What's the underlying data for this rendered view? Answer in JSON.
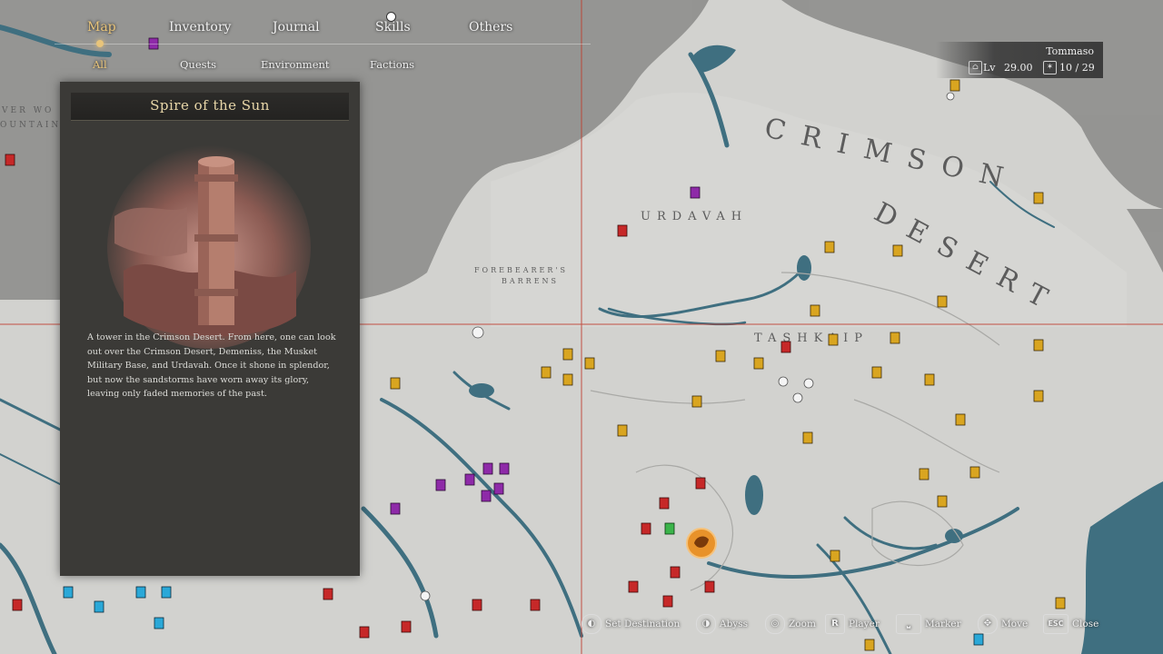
{
  "nav": {
    "tabs": [
      {
        "label": "Map",
        "active": true
      },
      {
        "label": "Inventory",
        "active": false
      },
      {
        "label": "Journal",
        "active": false
      },
      {
        "label": "Skills",
        "active": false
      },
      {
        "label": "Others",
        "active": false
      }
    ],
    "subtabs": [
      {
        "label": "All",
        "active": true
      },
      {
        "label": "Quests",
        "active": false
      },
      {
        "label": "Environment",
        "active": false
      },
      {
        "label": "Factions",
        "active": false
      }
    ]
  },
  "location_panel": {
    "title": "Spire of the Sun",
    "description": "A tower in the Crimson Desert. From here, one can look out over the Crimson Desert, Demeniss, the Musket Military Base, and Urdavah. Once it shone in splendor, but now the sandstorms have worn away its glory, leaving only faded memories of the past."
  },
  "player": {
    "name": "Tommaso",
    "level_label": "Lv",
    "level": "29.00",
    "counter": "10 / 29"
  },
  "map_labels": {
    "crimson": "CRIMSON",
    "desert": "DESERT",
    "urdavah": "URDAVAH",
    "forebearers": "FOREBEARER'S",
    "barrens": "BARRENS",
    "tashkaip": "TASHKAIP",
    "left_edge_1": "VER WO",
    "left_edge_2": "OUNTAIN"
  },
  "controls": [
    {
      "key": "",
      "label": "Set Destination"
    },
    {
      "key": "",
      "label": "Abyss"
    },
    {
      "key": "",
      "label": "Zoom"
    },
    {
      "key": "R",
      "label": "Player"
    },
    {
      "key": "",
      "label": "Marker"
    },
    {
      "key": "",
      "label": "Move"
    },
    {
      "key": "ESC",
      "label": "Close"
    }
  ],
  "colors": {
    "water": "#3f6f80",
    "land": "#cfcfcc",
    "fog": "#8d8d8d",
    "accent_gold": "#e8c47a",
    "crosshair": "#c0392b"
  }
}
